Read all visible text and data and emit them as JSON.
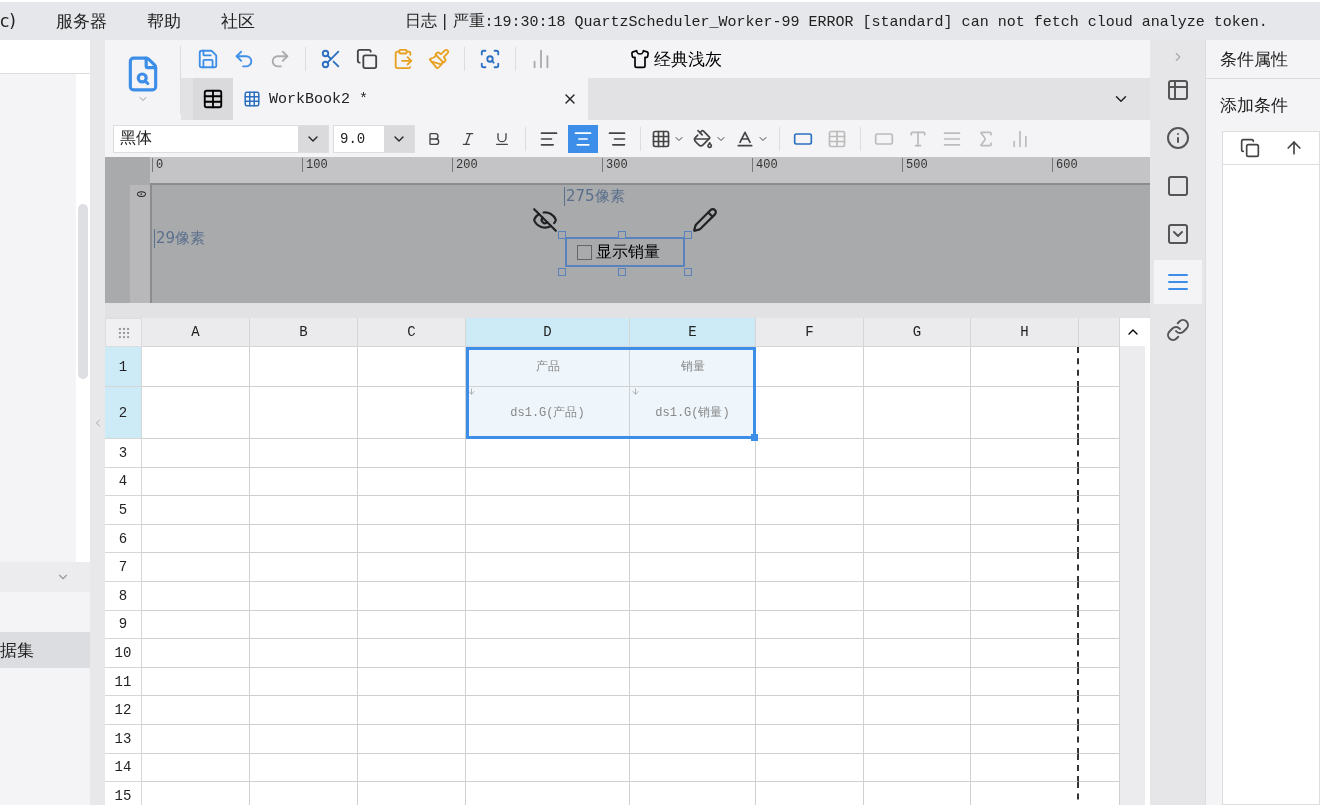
{
  "menu": [
    {
      "label": "c)"
    },
    {
      "label": "服务器"
    },
    {
      "label": "帮助"
    },
    {
      "label": "社区"
    }
  ],
  "log": {
    "prefix": "日志 | 严重",
    "message": ":19:30:18 QuartzScheduler_Worker-99 ERROR [standard] can not fetch cloud analyze token."
  },
  "left_panel": {
    "item": "据集"
  },
  "toolbar": {
    "theme": "经典浅灰"
  },
  "tab": {
    "title": "WorkBook2 *"
  },
  "format": {
    "font": "黑体",
    "size": "9.0",
    "align": [
      {
        "kind": "left",
        "selected": false
      },
      {
        "kind": "center",
        "selected": true
      },
      {
        "kind": "right",
        "selected": false
      }
    ]
  },
  "parameter_pane": {
    "ruler": [
      "0",
      "100",
      "200",
      "300",
      "400",
      "500",
      "600"
    ],
    "vruler": "0",
    "width_label": "275像素",
    "height_label": "29像素",
    "widget": {
      "label": "显示销量",
      "checked": false
    }
  },
  "grid": {
    "columns": [
      {
        "label": "A",
        "selected": false
      },
      {
        "label": "B",
        "selected": false
      },
      {
        "label": "C",
        "selected": false
      },
      {
        "label": "D",
        "selected": true
      },
      {
        "label": "E",
        "selected": true
      },
      {
        "label": "F",
        "selected": false
      },
      {
        "label": "G",
        "selected": false
      },
      {
        "label": "H",
        "selected": false
      }
    ],
    "rows": [
      {
        "label": "1",
        "selected": true,
        "cells": [
          {
            "selected": false
          },
          {
            "selected": false
          },
          {
            "selected": false
          },
          {
            "text": "产品",
            "selected": true
          },
          {
            "text": "销量",
            "selected": true
          },
          {
            "selected": false
          },
          {
            "selected": false
          },
          {
            "selected": false
          }
        ]
      },
      {
        "label": "2",
        "selected": true,
        "cells": [
          {
            "selected": false
          },
          {
            "selected": false
          },
          {
            "selected": false
          },
          {
            "text": "ds1.G(产品)",
            "selected": true,
            "expand": true
          },
          {
            "text": "ds1.G(销量)",
            "selected": true,
            "expand": true
          },
          {
            "selected": false
          },
          {
            "selected": false
          },
          {
            "selected": false
          }
        ]
      },
      {
        "label": "3",
        "selected": false
      },
      {
        "label": "4",
        "selected": false
      },
      {
        "label": "5",
        "selected": false
      },
      {
        "label": "6",
        "selected": false
      },
      {
        "label": "7",
        "selected": false
      },
      {
        "label": "8",
        "selected": false
      },
      {
        "label": "9",
        "selected": false
      },
      {
        "label": "10",
        "selected": false
      },
      {
        "label": "11",
        "selected": false
      },
      {
        "label": "12",
        "selected": false
      },
      {
        "label": "13",
        "selected": false
      },
      {
        "label": "14",
        "selected": false
      },
      {
        "label": "15",
        "selected": false
      }
    ]
  },
  "side_tools": [
    {
      "kind": "cell",
      "selected": false
    },
    {
      "kind": "info",
      "selected": false
    },
    {
      "kind": "frame",
      "selected": false
    },
    {
      "kind": "dropdown",
      "selected": false
    },
    {
      "kind": "condition",
      "selected": true
    },
    {
      "kind": "link",
      "selected": false
    }
  ],
  "right_panel": {
    "title": "条件属性",
    "add_label": "添加条件"
  }
}
